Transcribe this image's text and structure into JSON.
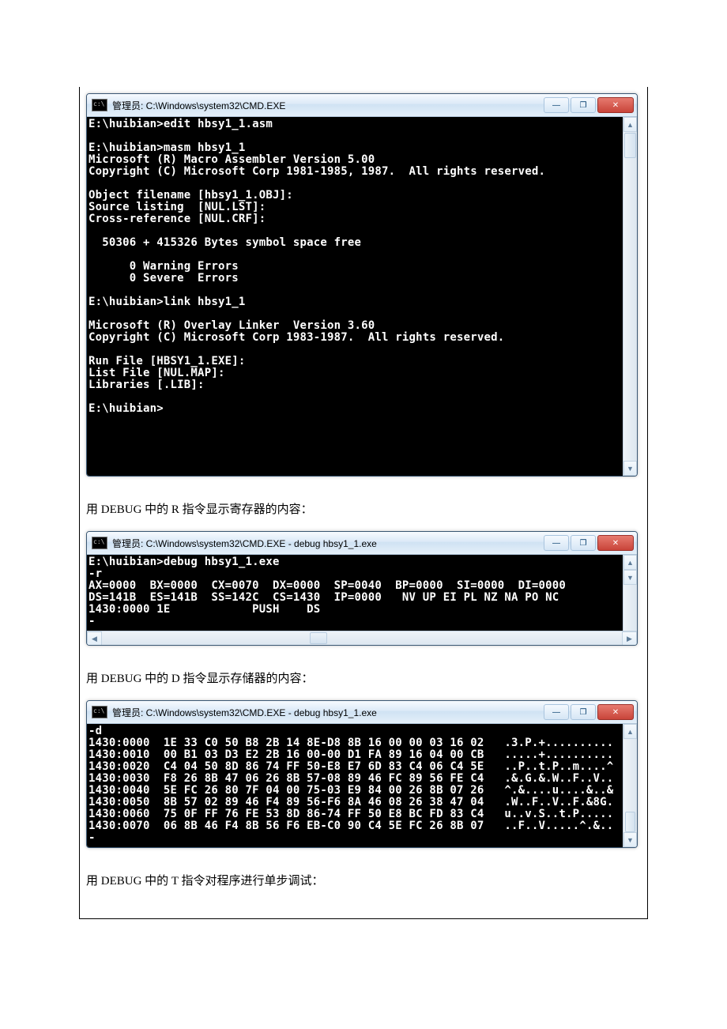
{
  "win1": {
    "title": "管理员: C:\\Windows\\system32\\CMD.EXE",
    "body": "E:\\huibian>edit hbsy1_1.asm\n\nE:\\huibian>masm hbsy1_1\nMicrosoft (R) Macro Assembler Version 5.00\nCopyright (C) Microsoft Corp 1981-1985, 1987.  All rights reserved.\n\nObject filename [hbsy1_1.OBJ]:\nSource listing  [NUL.LST]:\nCross-reference [NUL.CRF]:\n\n  50306 + 415326 Bytes symbol space free\n\n      0 Warning Errors\n      0 Severe  Errors\n\nE:\\huibian>link hbsy1_1\n\nMicrosoft (R) Overlay Linker  Version 3.60\nCopyright (C) Microsoft Corp 1983-1987.  All rights reserved.\n\nRun File [HBSY1_1.EXE]:\nList File [NUL.MAP]:\nLibraries [.LIB]:\n\nE:\\huibian>"
  },
  "caption1": "用 DEBUG 中的 R 指令显示寄存器的内容：",
  "win2": {
    "title": "管理员: C:\\Windows\\system32\\CMD.EXE - debug  hbsy1_1.exe",
    "body": "E:\\huibian>debug hbsy1_1.exe\n-r\nAX=0000  BX=0000  CX=0070  DX=0000  SP=0040  BP=0000  SI=0000  DI=0000\nDS=141B  ES=141B  SS=142C  CS=1430  IP=0000   NV UP EI PL NZ NA PO NC\n1430:0000 1E            PUSH    DS\n-"
  },
  "caption2": "用 DEBUG 中的 D 指令显示存储器的内容：",
  "win3": {
    "title": "管理员: C:\\Windows\\system32\\CMD.EXE - debug  hbsy1_1.exe",
    "body": "-d\n1430:0000  1E 33 C0 50 B8 2B 14 8E-D8 8B 16 00 00 03 16 02   .3.P.+..........\n1430:0010  00 B1 03 D3 E2 2B 16 00-00 D1 FA 89 16 04 00 CB   .....+..........\n1430:0020  C4 04 50 8D 86 74 FF 50-E8 E7 6D 83 C4 06 C4 5E   ..P..t.P..m....^\n1430:0030  F8 26 8B 47 06 26 8B 57-08 89 46 FC 89 56 FE C4   .&.G.&.W..F..V..\n1430:0040  5E FC 26 80 7F 04 00 75-03 E9 84 00 26 8B 07 26   ^.&....u....&..&\n1430:0050  8B 57 02 89 46 F4 89 56-F6 8A 46 08 26 38 47 04   .W..F..V..F.&8G.\n1430:0060  75 0F FF 76 FE 53 8D 86-74 FF 50 E8 BC FD 83 C4   u..v.S..t.P.....\n1430:0070  06 8B 46 F4 8B 56 F6 EB-C0 90 C4 5E FC 26 8B 07   ..F..V.....^.&..\n-"
  },
  "caption3": "用 DEBUG 中的 T 指令对程序进行单步调试：",
  "btn": {
    "min": "—",
    "max": "❐",
    "close": "✕"
  },
  "arrow": {
    "up": "▲",
    "down": "▼",
    "left": "◀",
    "right": "▶"
  }
}
